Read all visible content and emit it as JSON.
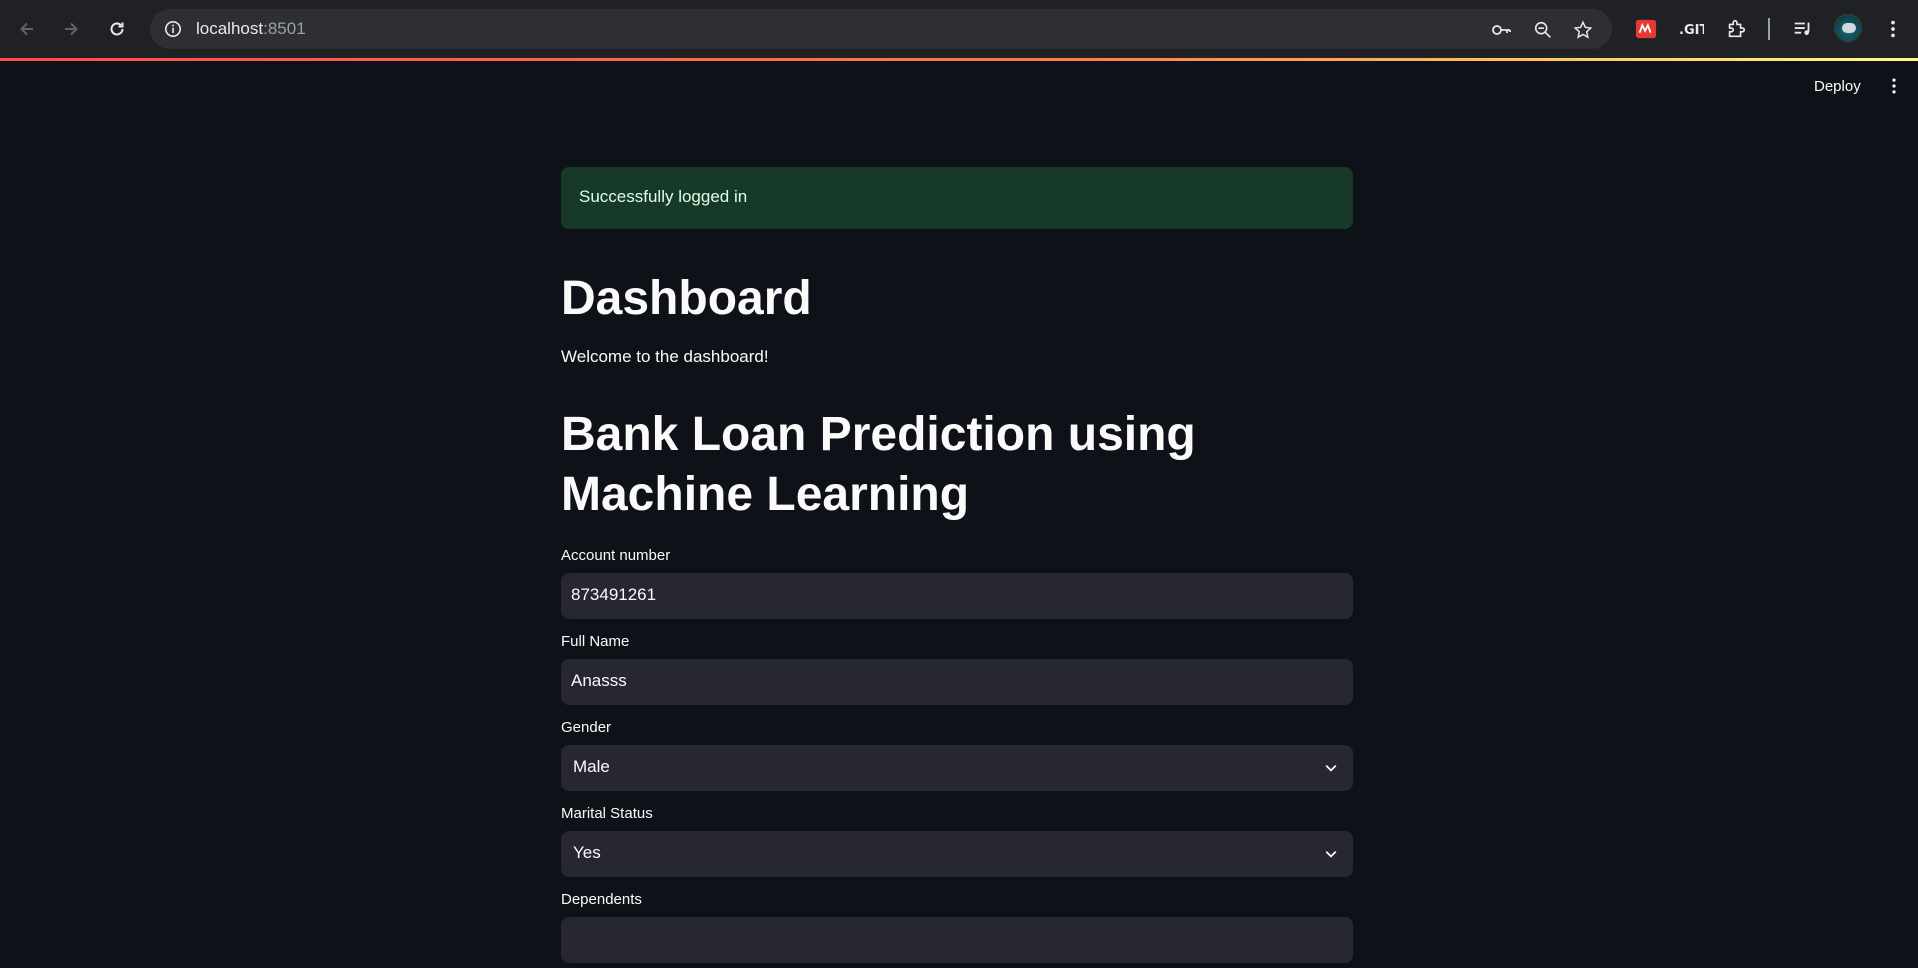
{
  "browser": {
    "url_host": "localhost",
    "url_port": ":8501"
  },
  "header": {
    "deploy_label": "Deploy"
  },
  "main": {
    "alert_text": "Successfully logged in",
    "dashboard_title": "Dashboard",
    "welcome_text": "Welcome to the dashboard!",
    "app_title": "Bank Loan Prediction using Machine Learning",
    "fields": {
      "account": {
        "label": "Account number",
        "value": "873491261"
      },
      "full_name": {
        "label": "Full Name",
        "value": "Anasss"
      },
      "gender": {
        "label": "Gender",
        "value": "Male"
      },
      "marital": {
        "label": "Marital Status",
        "value": "Yes"
      },
      "dependents": {
        "label": "Dependents"
      }
    }
  },
  "colors": {
    "page_bg": "#0e1117",
    "alert_bg": "#173928",
    "input_bg": "#262730",
    "accent": "#ff4b4b"
  }
}
